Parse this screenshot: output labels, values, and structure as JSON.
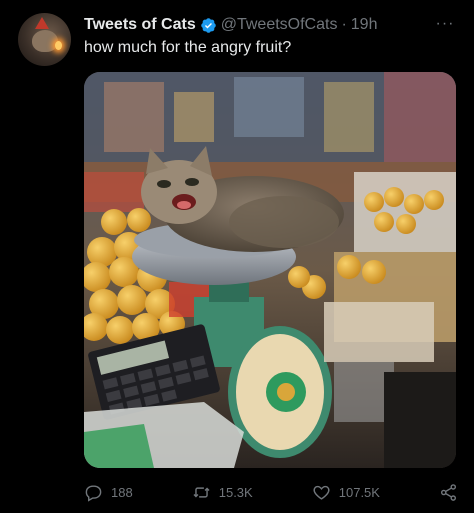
{
  "tweet": {
    "display_name": "Tweets of Cats",
    "handle": "@TweetsOfCats",
    "separator": "·",
    "time": "19h",
    "text": "how much for the angry fruit?",
    "more": "···"
  },
  "actions": {
    "replies": "188",
    "retweets": "15.3K",
    "likes": "107.5K"
  },
  "colors": {
    "background": "#000000",
    "text": "#e7e9ea",
    "muted": "#71767b",
    "verified": "#1d9bf0"
  },
  "icons": [
    "verified-icon",
    "more-icon",
    "reply-icon",
    "retweet-icon",
    "like-icon",
    "share-icon"
  ]
}
